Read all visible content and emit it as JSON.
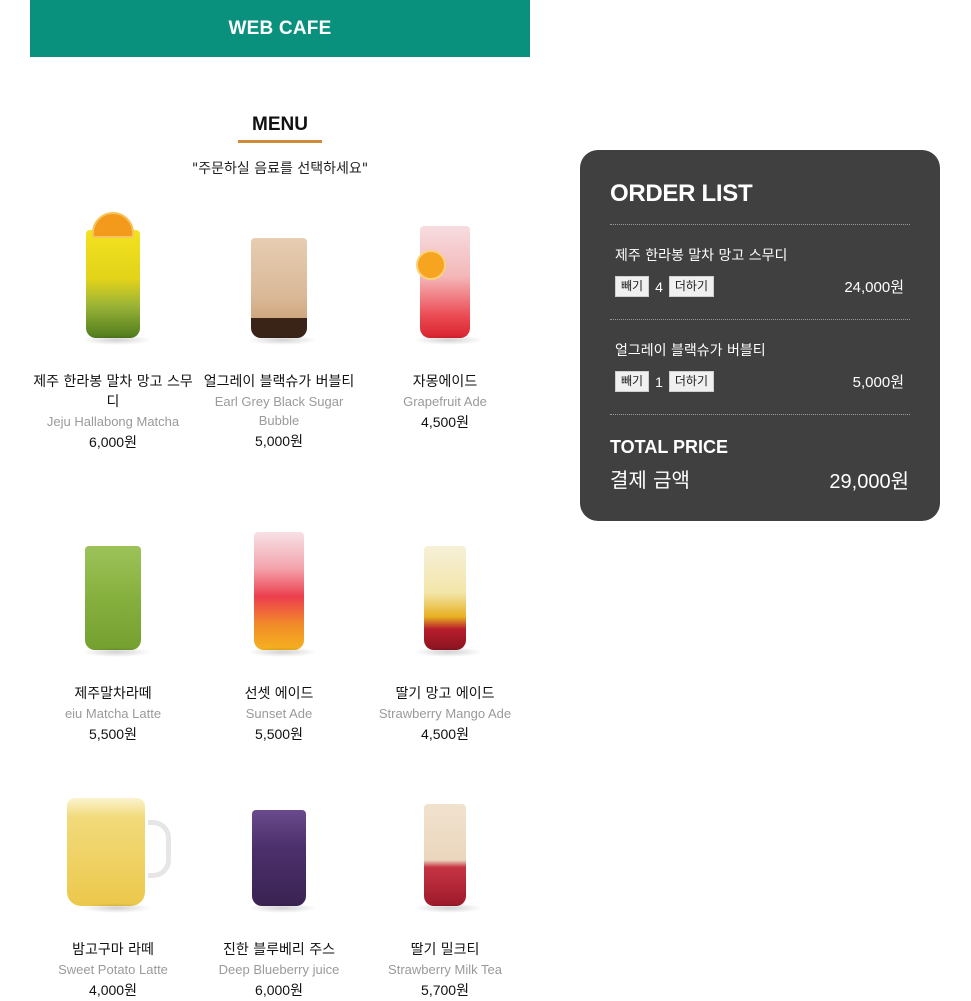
{
  "header": {
    "title": "WEB CAFE"
  },
  "menu": {
    "title": "MENU",
    "subtitle": "\"주문하실 음료를 선택하세요\"",
    "items": [
      {
        "ko": "제주 한라봉 말차 망고 스무디",
        "en": "Jeju Hallabong Matcha",
        "price": "6,000원"
      },
      {
        "ko": "얼그레이 블랙슈가 버블티",
        "en": "Earl Grey Black Sugar Bubble",
        "price": "5,000원"
      },
      {
        "ko": "자몽에이드",
        "en": "Grapefruit Ade",
        "price": "4,500원"
      },
      {
        "ko": "제주말차라떼",
        "en": "eiu Matcha Latte",
        "price": "5,500원"
      },
      {
        "ko": "선셋 에이드",
        "en": "Sunset Ade",
        "price": "5,500원"
      },
      {
        "ko": "딸기 망고 에이드",
        "en": "Strawberry Mango Ade",
        "price": "4,500원"
      },
      {
        "ko": "밤고구마 라떼",
        "en": "Sweet Potato Latte",
        "price": "4,000원"
      },
      {
        "ko": "진한 블루베리 주스",
        "en": "Deep Blueberry juice",
        "price": "6,000원"
      },
      {
        "ko": "딸기 밀크티",
        "en": "Strawberry Milk Tea",
        "price": "5,700원"
      }
    ]
  },
  "order": {
    "title": "ORDER LIST",
    "items": [
      {
        "name": "제주 한라봉 말차 망고 스무디",
        "minus_label": "빼기",
        "qty": "4",
        "plus_label": "더하기",
        "price": "24,000원"
      },
      {
        "name": "얼그레이 블랙슈가 버블티",
        "minus_label": "빼기",
        "qty": "1",
        "plus_label": "더하기",
        "price": "5,000원"
      }
    ],
    "total_label": "TOTAL PRICE",
    "total_label_ko": "결제 금액",
    "total_amount": "29,000원"
  },
  "colors": {
    "header_bg": "#0a917e",
    "menu_underline": "#cf8a3a",
    "order_panel_bg": "#404040"
  }
}
